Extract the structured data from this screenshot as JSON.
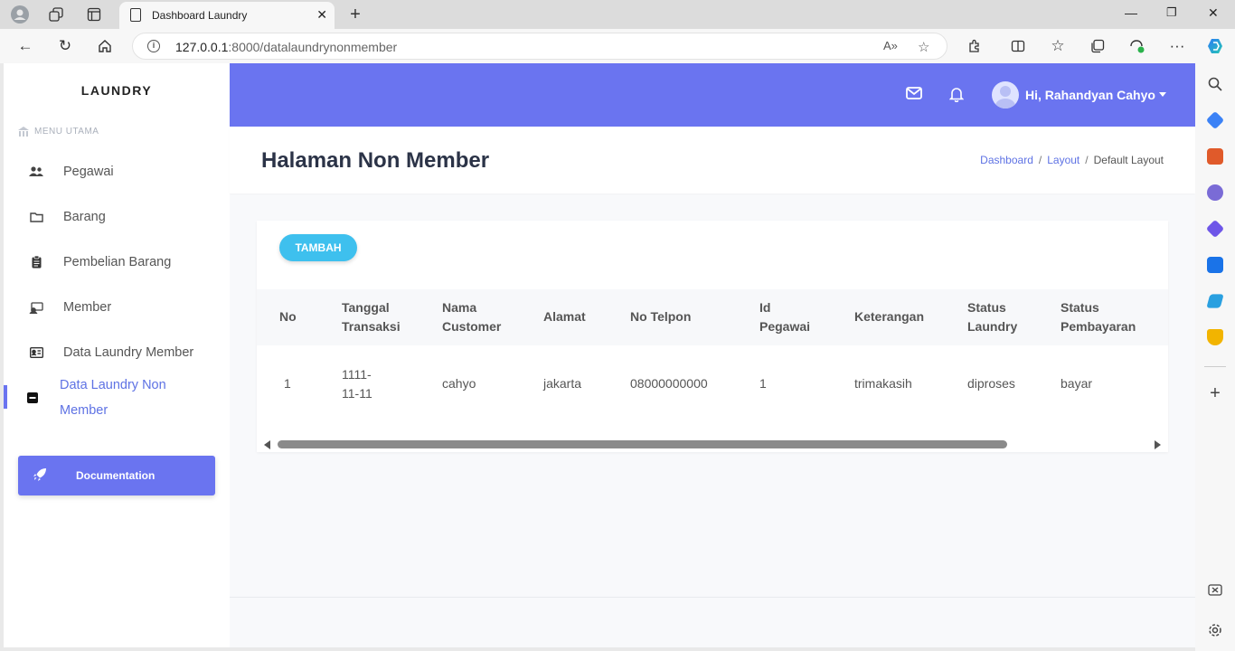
{
  "browser": {
    "tab_title": "Dashboard Laundry",
    "url_host": "127.0.0.1",
    "url_rest": ":8000/datalaundrynonmember"
  },
  "sidebar": {
    "brand": "LAUNDRY",
    "menu_heading": "MENU UTAMA",
    "items": [
      {
        "label": "Pegawai",
        "icon": "users-icon"
      },
      {
        "label": "Barang",
        "icon": "folder-icon"
      },
      {
        "label": "Pembelian Barang",
        "icon": "clipboard-icon"
      },
      {
        "label": "Member",
        "icon": "member-card-icon"
      },
      {
        "label": "Data Laundry Member",
        "icon": "id-card-icon"
      },
      {
        "label": "Data Laundry Non Member",
        "icon": "minus-square-icon",
        "active": true
      }
    ],
    "doc_button": "Documentation"
  },
  "topbar": {
    "user_name": "Hi, Rahandyan Cahyo"
  },
  "page": {
    "title": "Halaman Non Member",
    "breadcrumb": [
      "Dashboard",
      "Layout",
      "Default Layout"
    ]
  },
  "table": {
    "add_button": "TAMBAH",
    "headers": [
      [
        "No"
      ],
      [
        "Tanggal",
        "Transaksi"
      ],
      [
        "Nama",
        "Customer"
      ],
      [
        "Alamat"
      ],
      [
        "No Telpon"
      ],
      [
        "Id",
        "Pegawai"
      ],
      [
        "Keterangan"
      ],
      [
        "Status",
        "Laundry"
      ],
      [
        "Status",
        "Pembayaran"
      ]
    ],
    "rows": [
      {
        "no": "1",
        "tanggal": [
          "1111-",
          "11-11"
        ],
        "nama": "cahyo",
        "alamat": "jakarta",
        "telpon": "08000000000",
        "id_pegawai": "1",
        "keterangan": "trimakasih",
        "status_laundry": "diproses",
        "status_pembayaran": "bayar"
      }
    ]
  },
  "colors": {
    "accent": "#6a74f0",
    "button_info": "#3ec0ee",
    "active_link": "#5e72e4"
  }
}
